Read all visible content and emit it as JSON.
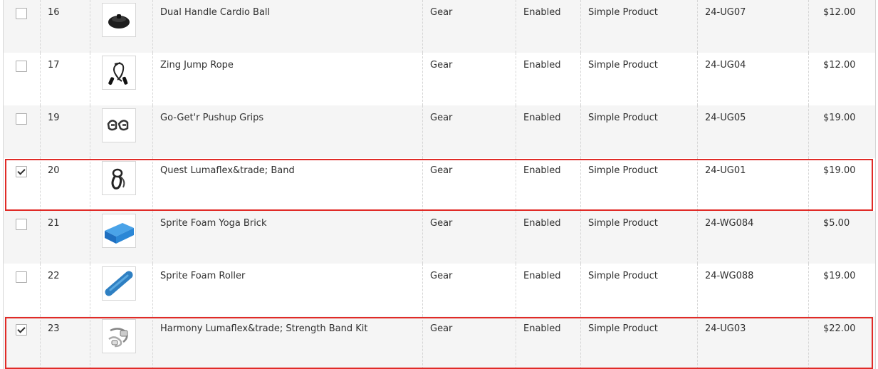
{
  "rows": [
    {
      "id": "16",
      "name": "Dual Handle Cardio Ball",
      "type": "Gear",
      "status": "Enabled",
      "product_type": "Simple Product",
      "sku": "24-UG07",
      "price": "$12.00",
      "checked": false,
      "thumb": "cardio-ball-image"
    },
    {
      "id": "17",
      "name": "Zing Jump Rope",
      "type": "Gear",
      "status": "Enabled",
      "product_type": "Simple Product",
      "sku": "24-UG04",
      "price": "$12.00",
      "checked": false,
      "thumb": "jump-rope-image"
    },
    {
      "id": "19",
      "name": "Go-Get'r Pushup Grips",
      "type": "Gear",
      "status": "Enabled",
      "product_type": "Simple Product",
      "sku": "24-UG05",
      "price": "$19.00",
      "checked": false,
      "thumb": "pushup-grips-image"
    },
    {
      "id": "20",
      "name": "Quest Lumaflex&trade; Band",
      "type": "Gear",
      "status": "Enabled",
      "product_type": "Simple Product",
      "sku": "24-UG01",
      "price": "$19.00",
      "checked": true,
      "thumb": "lumaflex-band-image"
    },
    {
      "id": "21",
      "name": "Sprite Foam Yoga Brick",
      "type": "Gear",
      "status": "Enabled",
      "product_type": "Simple Product",
      "sku": "24-WG084",
      "price": "$5.00",
      "checked": false,
      "thumb": "yoga-brick-image"
    },
    {
      "id": "22",
      "name": "Sprite Foam Roller",
      "type": "Gear",
      "status": "Enabled",
      "product_type": "Simple Product",
      "sku": "24-WG088",
      "price": "$19.00",
      "checked": false,
      "thumb": "foam-roller-image"
    },
    {
      "id": "23",
      "name": "Harmony Lumaflex&trade; Strength Band Kit",
      "type": "Gear",
      "status": "Enabled",
      "product_type": "Simple Product",
      "sku": "24-UG03",
      "price": "$22.00",
      "checked": true,
      "thumb": "strength-band-kit-image"
    }
  ],
  "colors": {
    "selection_border": "#e02b27",
    "row_alt": "#f5f5f5"
  }
}
